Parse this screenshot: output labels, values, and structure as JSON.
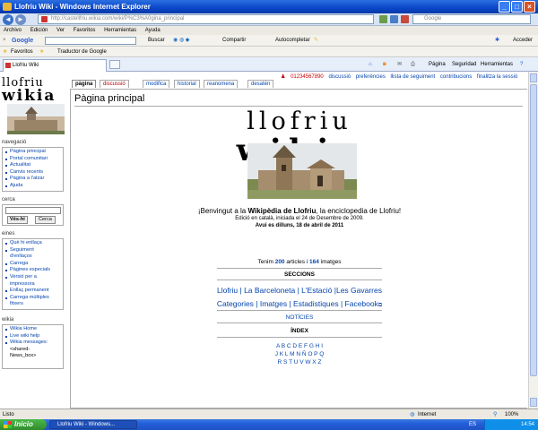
{
  "window": {
    "title": "Llofriu Wiki - Windows Internet Explorer"
  },
  "address": {
    "url": "http://castellfriu.wikia.com/wiki/P%C3%A0gina_principal",
    "search_placeholder": "Google"
  },
  "menu": [
    "Archivo",
    "Edición",
    "Ver",
    "Favoritos",
    "Herramientas",
    "Ayuda"
  ],
  "google_bar": {
    "brand": "Google",
    "search": "Buscar",
    "share": "Compartir",
    "autofill": "Autocompletar",
    "signin": "Acceder"
  },
  "favorites_bar": {
    "favorites": "Favoritos",
    "translator": "Traductor de Google"
  },
  "tab": {
    "label": "Llofriu Wiki"
  },
  "command_bar": {
    "page": "Página",
    "safety": "Seguridad",
    "tools": "Herramientas"
  },
  "user_links": {
    "user": "01234567890",
    "discussion": "discussió",
    "preferences": "preferències",
    "watchlist": "llista de seguiment",
    "contributions": "contribucions",
    "logout": "finalitza la sessió"
  },
  "page_tabs": [
    "pàgina",
    "discussió",
    "modifica",
    "historial",
    "reanomena",
    "desatén"
  ],
  "logo": {
    "line1": "llofriu",
    "line2": "wikia"
  },
  "sidebar": {
    "nav_title": "navegació",
    "nav_items": [
      "Pàgina principal",
      "Portal comunitari",
      "Actualitat",
      "Canvis recents",
      "Pàgina a l'atzar",
      "Ajuda"
    ],
    "search_title": "cerca",
    "go_button": "Vés-hi",
    "search_button": "Cerca",
    "tools_title": "eines",
    "tools_items": [
      "Què hi enllaça",
      "Seguiment d'enllaços",
      "Carrega",
      "Pàgines especials",
      "Versió per a impressora",
      "Enllaç permanent",
      "Carrega múltiples fitxers"
    ],
    "wikia_title": "wikia",
    "wikia_items": [
      "Wikia Home",
      "Live wiki help",
      "Wikia messages:"
    ],
    "shared_news": "<shared-News_box>"
  },
  "content": {
    "title": "Pàgina principal",
    "welcome_pre": "¡Benvingut a la ",
    "welcome_link": "Wikipèdia de Llofriu",
    "welcome_post": ", la enciclopedia de Llofriu!",
    "edition": "Edició en català, iniciada el 24 de Desembre de 2009.",
    "today": "Avui es dilluns, 18 de abril de 2011",
    "stats_pre": "Tenim ",
    "articles": "200",
    "stats_mid": " articles i ",
    "images": "164",
    "stats_post": " imatges",
    "sections_heading": "SECCIONS",
    "sections_row1": "Llofriu | La Barceloneta | L'Estació |Les Gavarres",
    "sections_row2": "Categories | Imatges | Estadistiques | Facebook",
    "news": "NOTÍCIES",
    "index_heading": "ÍNDEX",
    "index_row1": "A B C D E F G H I",
    "index_row2": "J K L M N Ñ O P Q",
    "index_row3": "R S T U V W X Z"
  },
  "status": {
    "left": "Listo",
    "zone": "Internet",
    "zoom": "100%"
  },
  "taskbar": {
    "start": "Inicio",
    "task": "Llofriu Wiki - Windows...",
    "lang": "ES",
    "clock": "14:54"
  },
  "colors": {
    "link": "#0645ad",
    "accent": "#245edb"
  }
}
